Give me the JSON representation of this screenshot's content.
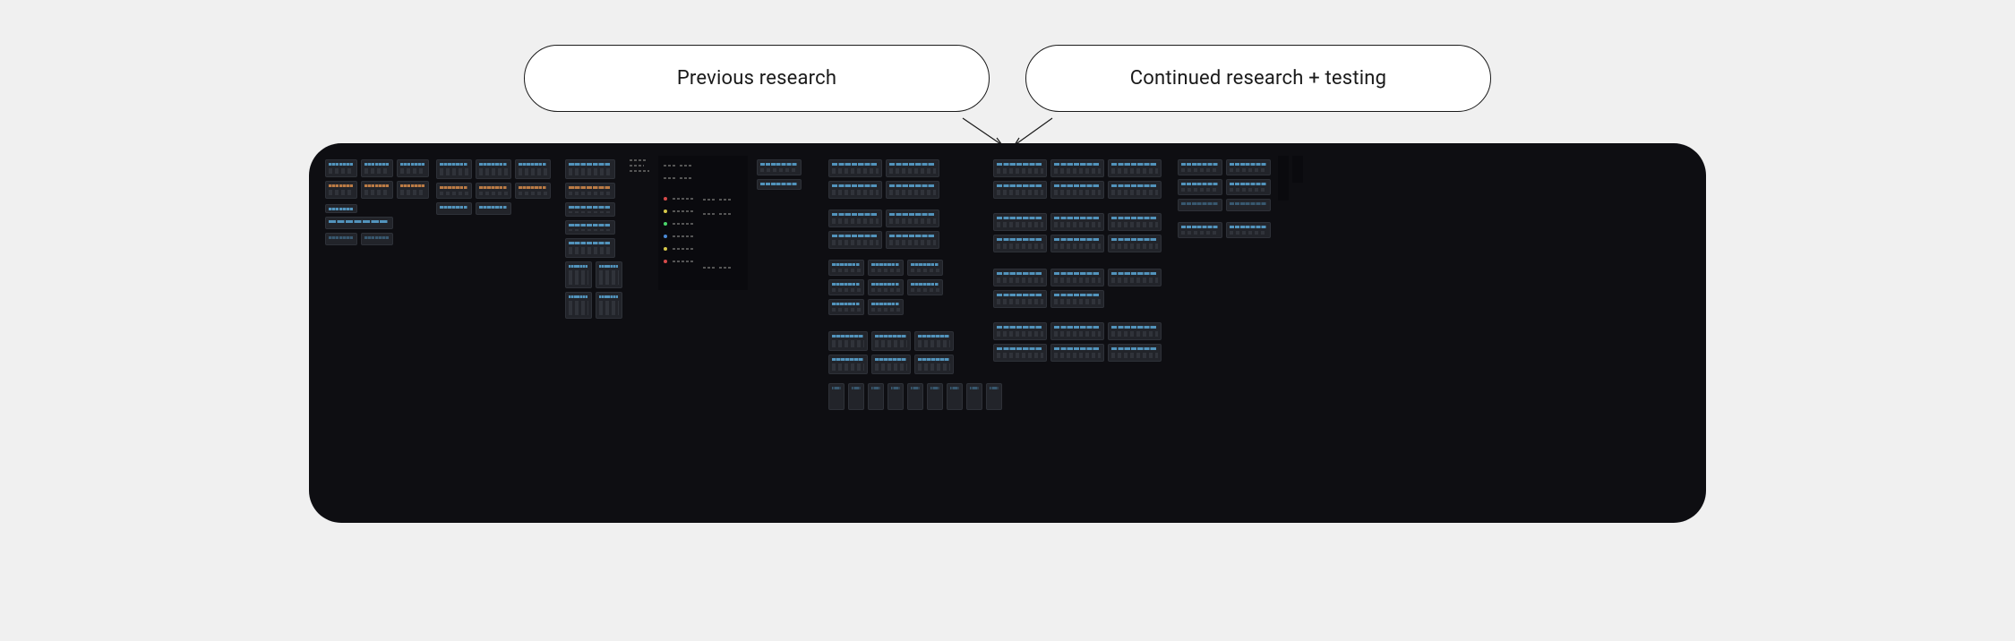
{
  "labels": {
    "previous": "Previous research",
    "continued": "Continued research + testing"
  },
  "canvas": {
    "description": "design-tool dark canvas with many small UI mockup frames"
  }
}
